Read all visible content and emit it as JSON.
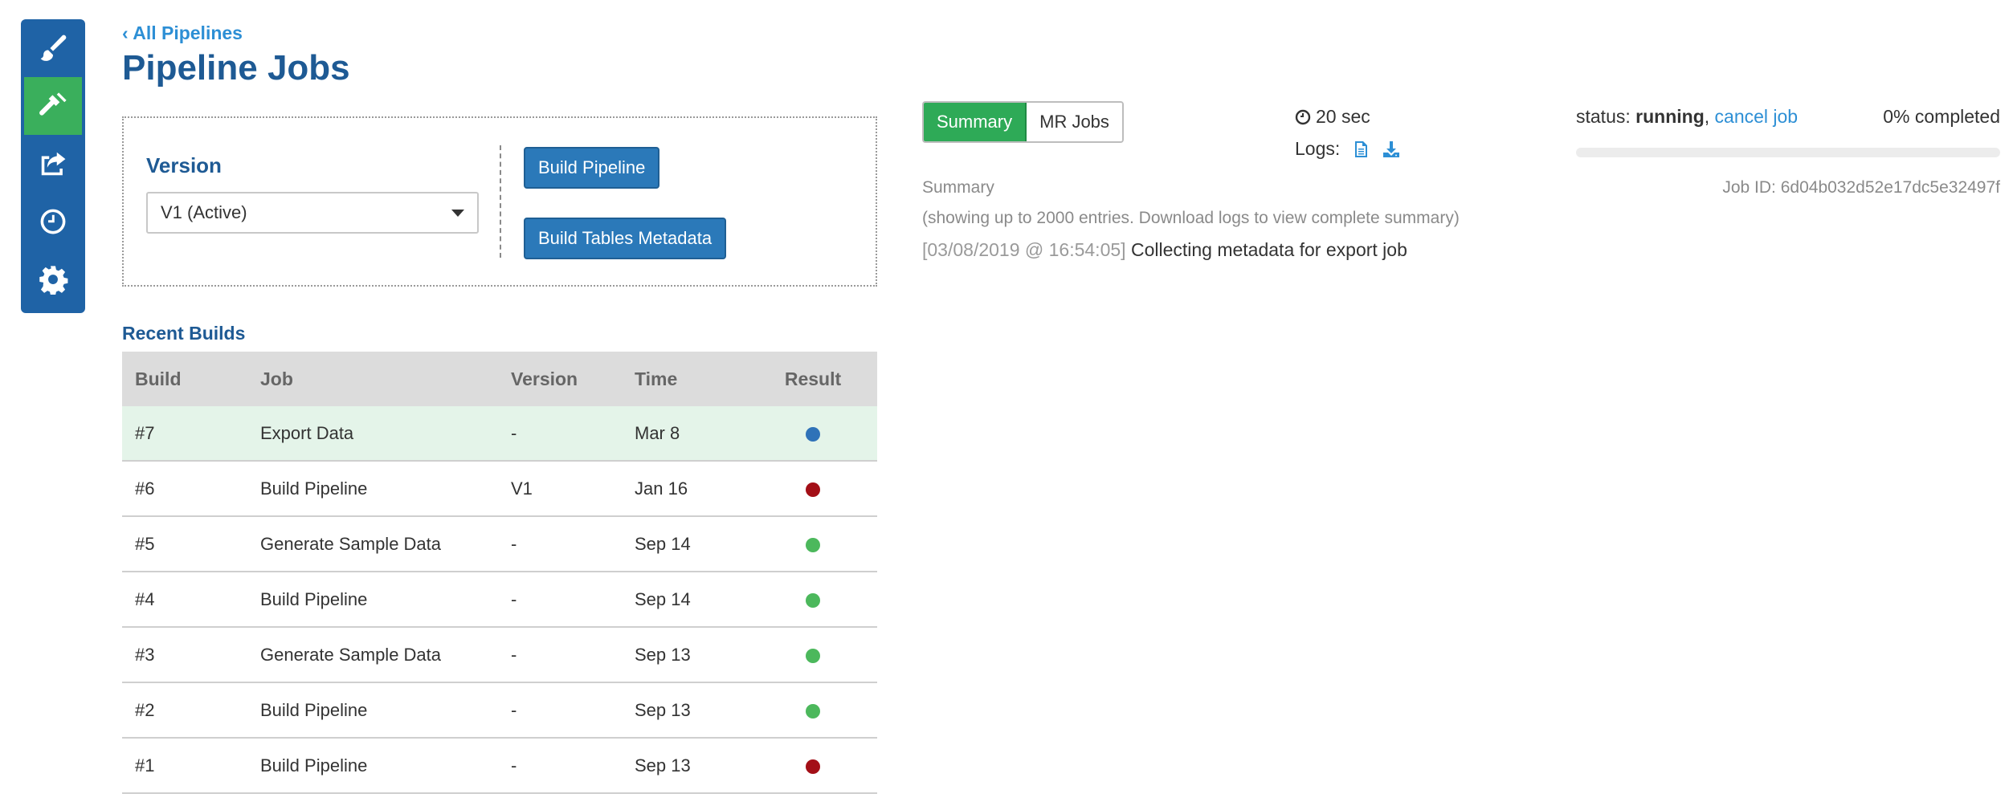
{
  "sidebar": {
    "items": [
      {
        "icon": "paint-brush-icon",
        "active": false
      },
      {
        "icon": "hammer-icon",
        "active": true
      },
      {
        "icon": "share-icon",
        "active": false
      },
      {
        "icon": "clock-icon",
        "active": false
      },
      {
        "icon": "gear-icon",
        "active": false
      }
    ],
    "colors": {
      "background": "#1f63a6",
      "active": "#3aaf5c"
    }
  },
  "header": {
    "back_link": "All Pipelines",
    "title": "Pipeline Jobs"
  },
  "version_panel": {
    "label": "Version",
    "selected": "V1 (Active)",
    "build_pipeline_label": "Build Pipeline",
    "build_tables_label": "Build Tables Metadata"
  },
  "recent_builds": {
    "title": "Recent Builds",
    "columns": [
      "Build",
      "Job",
      "Version",
      "Time",
      "Result"
    ],
    "rows": [
      {
        "build": "#7",
        "job": "Export Data",
        "version": "-",
        "time": "Mar 8",
        "result": "running",
        "color": "#2f72b8",
        "highlight": true
      },
      {
        "build": "#6",
        "job": "Build Pipeline",
        "version": "V1",
        "time": "Jan 16",
        "result": "failed",
        "color": "#a30f17",
        "highlight": false
      },
      {
        "build": "#5",
        "job": "Generate Sample Data",
        "version": "-",
        "time": "Sep 14",
        "result": "success",
        "color": "#4cb85c",
        "highlight": false
      },
      {
        "build": "#4",
        "job": "Build Pipeline",
        "version": "-",
        "time": "Sep 14",
        "result": "success",
        "color": "#4cb85c",
        "highlight": false
      },
      {
        "build": "#3",
        "job": "Generate Sample Data",
        "version": "-",
        "time": "Sep 13",
        "result": "success",
        "color": "#4cb85c",
        "highlight": false
      },
      {
        "build": "#2",
        "job": "Build Pipeline",
        "version": "-",
        "time": "Sep 13",
        "result": "success",
        "color": "#4cb85c",
        "highlight": false
      },
      {
        "build": "#1",
        "job": "Build Pipeline",
        "version": "-",
        "time": "Sep 13",
        "result": "failed",
        "color": "#a30f17",
        "highlight": false
      }
    ]
  },
  "job_detail": {
    "tabs": [
      "Summary",
      "MR Jobs"
    ],
    "duration": "20 sec",
    "logs_label": "Logs:",
    "status_prefix": "status:",
    "status_value": "running",
    "cancel_label": "cancel job",
    "percent_label": "0% completed",
    "progress_fraction": 0,
    "summary_label": "Summary",
    "job_id": "Job ID: 6d04b032d52e17dc5e32497f",
    "summary_note": "(showing up to 2000 entries. Download logs to view complete summary)",
    "log_entries": [
      {
        "timestamp": "[03/08/2019 @ 16:54:05]",
        "message": "Collecting metadata for export job"
      }
    ]
  }
}
